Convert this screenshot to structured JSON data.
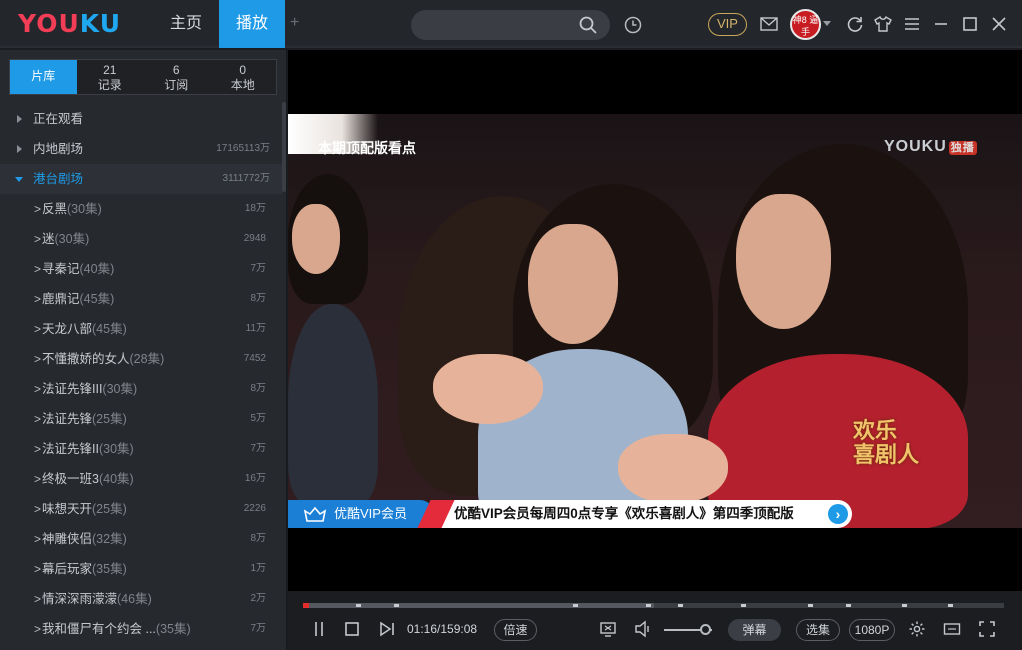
{
  "app": {
    "logo_you": "YOU",
    "logo_ku": "KU",
    "tabs": {
      "home": "主页",
      "play": "播放",
      "add": "+"
    },
    "vip": "VIP",
    "avatar_text": "神8 逼 手",
    "accent": "#1e9ae6"
  },
  "sidebar": {
    "tabs": [
      {
        "num": "",
        "label": "片库"
      },
      {
        "num": "21",
        "label": "记录"
      },
      {
        "num": "6",
        "label": "订阅"
      },
      {
        "num": "0",
        "label": "本地"
      }
    ],
    "categories": [
      {
        "label": "正在观看",
        "count": ""
      },
      {
        "label": "内地剧场",
        "count": "17165113万"
      },
      {
        "label": "港台剧场",
        "count": "3111772万"
      }
    ],
    "episodes": [
      {
        "title": "反黑",
        "eps": "(30集)",
        "count": "18万"
      },
      {
        "title": "迷",
        "eps": "(30集)",
        "count": "2948"
      },
      {
        "title": "寻秦记",
        "eps": "(40集)",
        "count": "7万"
      },
      {
        "title": "鹿鼎记",
        "eps": "(45集)",
        "count": "8万"
      },
      {
        "title": "天龙八部",
        "eps": "(45集)",
        "count": "11万"
      },
      {
        "title": "不懂撒娇的女人",
        "eps": "(28集)",
        "count": "7452"
      },
      {
        "title": "法证先锋III",
        "eps": "(30集)",
        "count": "8万"
      },
      {
        "title": "法证先锋",
        "eps": "(25集)",
        "count": "5万"
      },
      {
        "title": "法证先锋II",
        "eps": "(30集)",
        "count": "7万"
      },
      {
        "title": "终极一班3",
        "eps": "(40集)",
        "count": "16万"
      },
      {
        "title": "味想天开",
        "eps": "(25集)",
        "count": "2226"
      },
      {
        "title": "神雕侠侣",
        "eps": "(32集)",
        "count": "8万"
      },
      {
        "title": "幕后玩家",
        "eps": "(35集)",
        "count": "1万"
      },
      {
        "title": "情深深雨濛濛",
        "eps": "(46集)",
        "count": "2万"
      },
      {
        "title": "我和僵尸有个约会 ...",
        "eps": "(35集)",
        "count": "7万"
      }
    ]
  },
  "video": {
    "promo_title": "本期顶配版看点",
    "watermark": "YOUKU",
    "watermark_badge": "独播",
    "show_logo_line1": "欢乐",
    "show_logo_line2": "喜剧人",
    "banner_left": "优酷VIP会员",
    "banner_right": "优酷VIP会员每周四0点专享《欢乐喜剧人》第四季顶配版"
  },
  "controls": {
    "time": "01:16/159:08",
    "speed": "倍速",
    "danmu": "弹幕",
    "xuanji": "选集",
    "quality": "1080P",
    "progress_played": 0.008,
    "progress_buffered": 0.5,
    "volume": 0.85
  }
}
